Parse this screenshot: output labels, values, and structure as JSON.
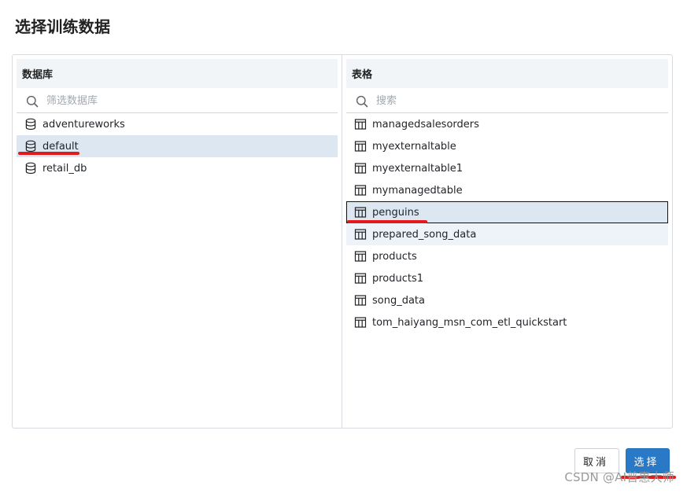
{
  "dialog": {
    "title": "选择训练数据"
  },
  "left_panel": {
    "header": "数据库",
    "search_placeholder": "筛选数据库",
    "items": [
      {
        "label": "adventureworks",
        "icon": "database-icon"
      },
      {
        "label": "default",
        "icon": "database-icon",
        "state": "selected"
      },
      {
        "label": "retail_db",
        "icon": "database-icon"
      }
    ]
  },
  "right_panel": {
    "header": "表格",
    "search_placeholder": "搜索",
    "items": [
      {
        "label": "managedsalesorders",
        "icon": "table-icon"
      },
      {
        "label": "myexternaltable",
        "icon": "table-icon"
      },
      {
        "label": "myexternaltable1",
        "icon": "table-icon"
      },
      {
        "label": "mymanagedtable",
        "icon": "table-icon"
      },
      {
        "label": "penguins",
        "icon": "table-icon",
        "state": "selected-focused"
      },
      {
        "label": "prepared_song_data",
        "icon": "table-icon",
        "state": "hovered"
      },
      {
        "label": "products",
        "icon": "table-icon"
      },
      {
        "label": "products1",
        "icon": "table-icon"
      },
      {
        "label": "song_data",
        "icon": "table-icon"
      },
      {
        "label": "tom_haiyang_msn_com_etl_quickstart",
        "icon": "table-icon"
      }
    ]
  },
  "footer": {
    "cancel_label": "取消",
    "select_label": "选择"
  },
  "watermark": "CSDN @AI普惠大师",
  "colors": {
    "primary_button": "#2979c7",
    "selected_row": "#dde7f1",
    "hover_row": "#edf3f8",
    "annotation_mark": "#e11b1b",
    "panel_header": "#f1f5f7"
  }
}
